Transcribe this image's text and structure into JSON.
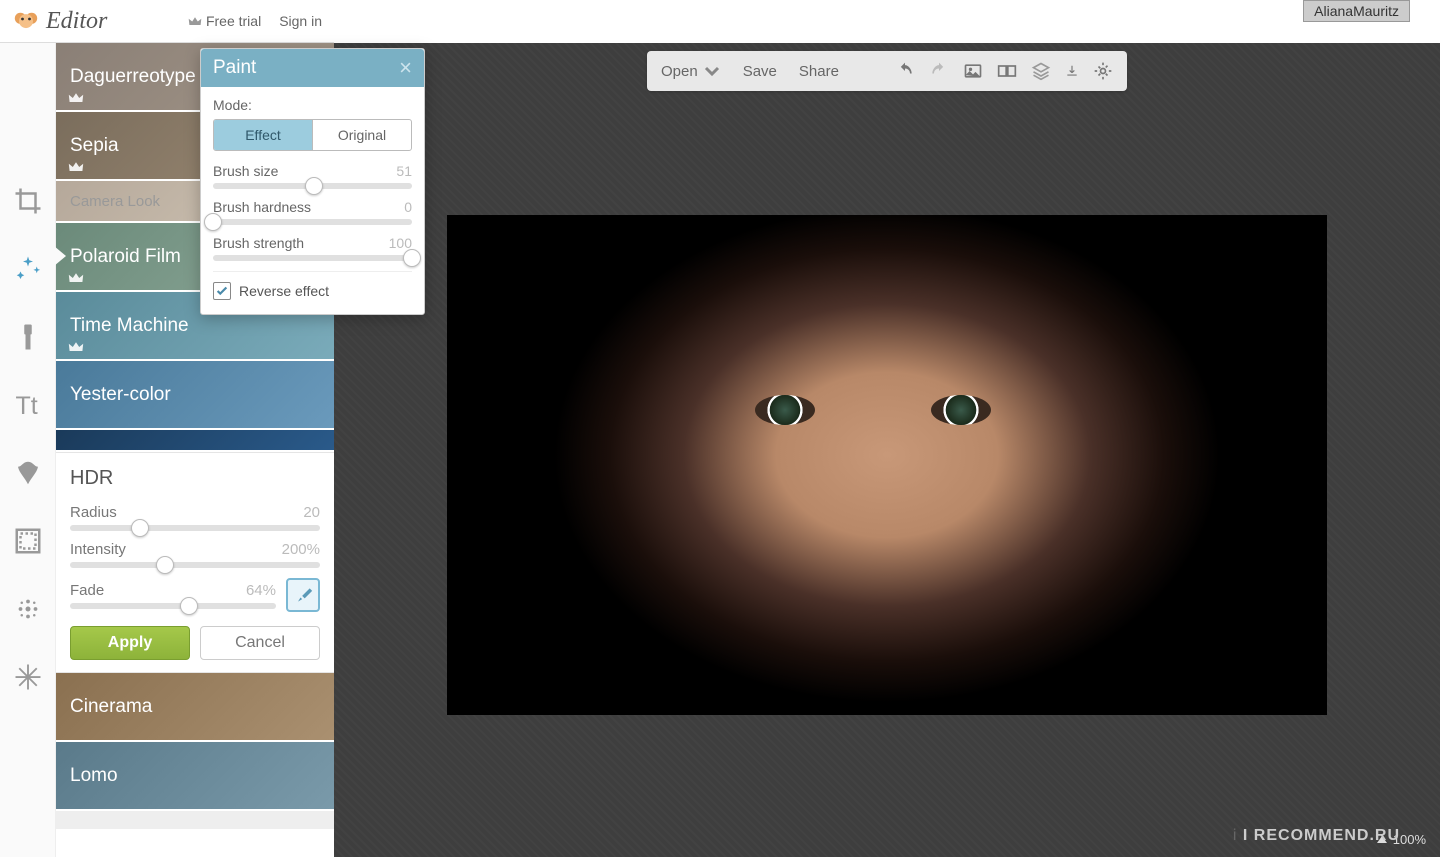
{
  "header": {
    "app_name": "Editor",
    "free_trial": "Free trial",
    "sign_in": "Sign in"
  },
  "effects": [
    {
      "label": "Daguerreotype",
      "premium": true
    },
    {
      "label": "Sepia",
      "premium": true
    },
    {
      "label": "Camera Look",
      "premium": false
    },
    {
      "label": "Polaroid Film",
      "premium": true
    },
    {
      "label": "Time Machine",
      "premium": true
    },
    {
      "label": "Yester-color",
      "premium": false
    },
    {
      "label": "Cinerama",
      "premium": false
    },
    {
      "label": "Lomo",
      "premium": false
    }
  ],
  "hdr": {
    "title": "HDR",
    "radius": {
      "label": "Radius",
      "value": "20",
      "pos": 28
    },
    "intensity": {
      "label": "Intensity",
      "value": "200%",
      "pos": 38
    },
    "fade": {
      "label": "Fade",
      "value": "64%",
      "pos": 58
    },
    "apply": "Apply",
    "cancel": "Cancel"
  },
  "paint": {
    "title": "Paint",
    "mode_label": "Mode:",
    "effect": "Effect",
    "original": "Original",
    "brush_size": {
      "label": "Brush size",
      "value": "51",
      "pos": 51
    },
    "brush_hardness": {
      "label": "Brush hardness",
      "value": "0",
      "pos": 0
    },
    "brush_strength": {
      "label": "Brush strength",
      "value": "100",
      "pos": 100
    },
    "reverse": "Reverse effect",
    "reverse_checked": true
  },
  "toolbar": {
    "open": "Open",
    "save": "Save",
    "share": "Share"
  },
  "zoom": "100%",
  "username": "AlianaMauritz",
  "watermark": "I RECOMMEND.RU"
}
